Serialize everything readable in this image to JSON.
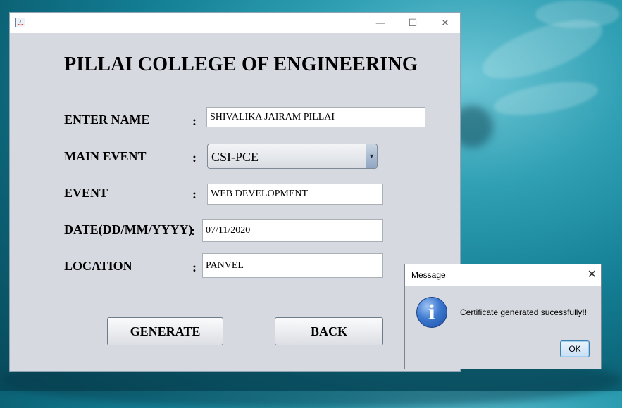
{
  "main_window": {
    "heading": "PILLAI COLLEGE OF ENGINEERING",
    "window_controls": {
      "minimize": "—",
      "maximize": "☐",
      "close": "✕"
    },
    "form": {
      "name": {
        "label": "ENTER NAME",
        "colon": ":",
        "value": "SHIVALIKA JAIRAM PILLAI"
      },
      "main_event": {
        "label": "MAIN EVENT",
        "colon": ":",
        "value": "CSI-PCE"
      },
      "event": {
        "label": "EVENT",
        "colon": ":",
        "value": "WEB DEVELOPMENT"
      },
      "date": {
        "label": "DATE(DD/MM/YYYY)",
        "colon": ":",
        "value": "07/11/2020"
      },
      "location": {
        "label": "LOCATION",
        "colon": ":",
        "value": "PANVEL"
      }
    },
    "buttons": {
      "generate": "GENERATE",
      "back": "BACK"
    }
  },
  "message_dialog": {
    "title": "Message",
    "close": "✕",
    "icon": "info-icon",
    "text": "Certificate generated sucessfully!!",
    "ok": "OK"
  },
  "colors": {
    "window_bg": "#d6d9df",
    "dialog_accent": "#3c7fb1",
    "desktop_water": "#147f95"
  }
}
